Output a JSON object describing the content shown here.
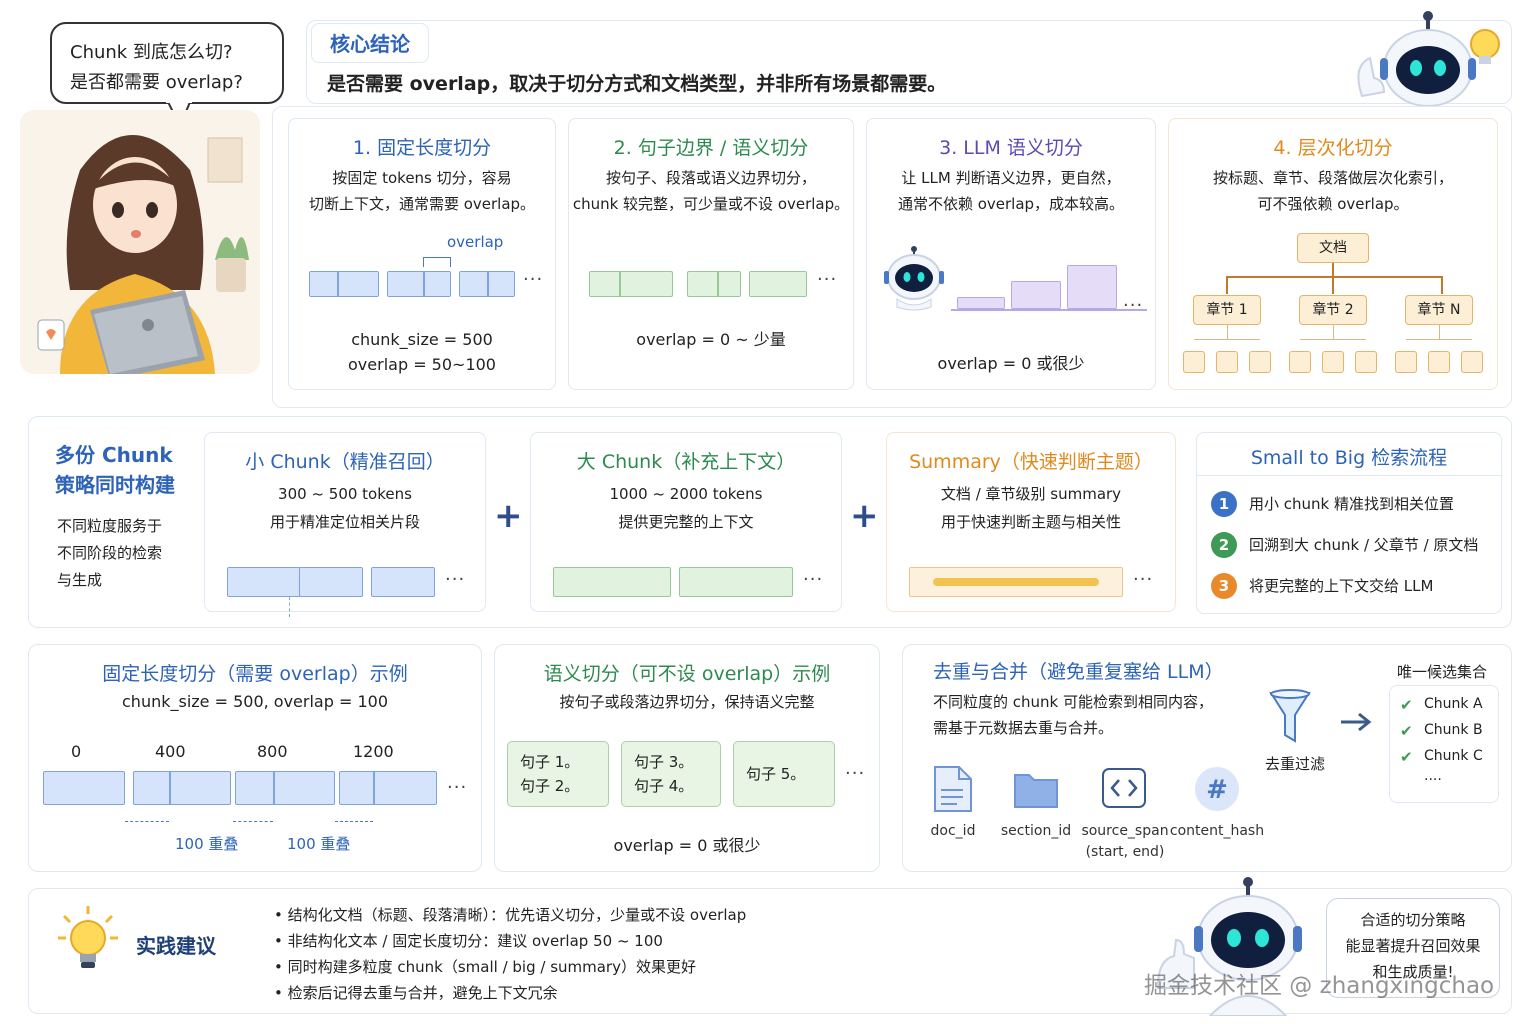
{
  "speech": {
    "line1": "Chunk 到底怎么切?",
    "line2": "是否都需要 overlap?"
  },
  "conclusion": {
    "tag": "核心结论",
    "text": "是否需要 overlap，取决于切分方式和文档类型，并非所有场景都需要。"
  },
  "methods": [
    {
      "title": "1. 固定长度切分",
      "desc1": "按固定 tokens 切分，容易",
      "desc2": "切断上下文，通常需要 overlap。",
      "overlap_label": "overlap",
      "param1": "chunk_size = 500",
      "param2": "overlap = 50~100"
    },
    {
      "title": "2. 句子边界 / 语义切分",
      "desc1": "按句子、段落或语义边界切分，",
      "desc2": "chunk 较完整，可少量或不设 overlap。",
      "param1": "overlap = 0 ~ 少量"
    },
    {
      "title": "3. LLM 语义切分",
      "desc1": "让 LLM 判断语义边界，更自然，",
      "desc2": "通常不依赖 overlap，成本较高。",
      "param1": "overlap = 0 或很少"
    },
    {
      "title": "4. 层次化切分",
      "desc1": "按标题、章节、段落做层次化索引，",
      "desc2": "可不强依赖 overlap。",
      "root": "文档",
      "nodes": [
        "章节 1",
        "章节 2",
        "章节 N"
      ]
    }
  ],
  "multi": {
    "title1": "多份 Chunk",
    "title2": "策略同时构建",
    "desc": [
      "不同粒度服务于",
      "不同阶段的检索",
      "与生成"
    ],
    "small": {
      "title": "小 Chunk（精准召回）",
      "l1": "300 ~ 500 tokens",
      "l2": "用于精准定位相关片段"
    },
    "big": {
      "title": "大 Chunk（补充上下文）",
      "l1": "1000 ~ 2000 tokens",
      "l2": "提供更完整的上下文"
    },
    "summary": {
      "title": "Summary（快速判断主题）",
      "l1": "文档 / 章节级别 summary",
      "l2": "用于快速判断主题与相关性"
    },
    "plus": "+",
    "flow": {
      "title": "Small to Big 检索流程",
      "steps": [
        {
          "n": "1",
          "text": "用小 chunk 精准找到相关位置"
        },
        {
          "n": "2",
          "text": "回溯到大 chunk / 父章节 / 原文档"
        },
        {
          "n": "3",
          "text": "将更完整的上下文交给 LLM"
        }
      ]
    }
  },
  "fixed_example": {
    "title": "固定长度切分（需要 overlap）示例",
    "params": "chunk_size = 500, overlap = 100",
    "ticks": [
      "0",
      "400",
      "800",
      "1200"
    ],
    "overlap1": "100 重叠",
    "overlap2": "100 重叠"
  },
  "semantic_example": {
    "title": "语义切分（可不设 overlap）示例",
    "desc": "按句子或段落边界切分，保持语义完整",
    "s1a": "句子 1。",
    "s1b": "句子 2。",
    "s2a": "句子 3。",
    "s2b": "句子 4。",
    "s3": "句子 5。",
    "foot": "overlap = 0 或很少"
  },
  "dedup": {
    "title": "去重与合并（避免重复塞给 LLM）",
    "desc1": "不同粒度的 chunk 可能检索到相同内容，",
    "desc2": "需基于元数据去重与合并。",
    "filter": "去重过滤",
    "set_title": "唯一候选集合",
    "items": [
      "Chunk A",
      "Chunk B",
      "Chunk C"
    ],
    "more": "....",
    "icons": [
      {
        "icon": "document-icon",
        "label": "doc_id",
        "label2": ""
      },
      {
        "icon": "folder-icon",
        "label": "section_id",
        "label2": ""
      },
      {
        "icon": "code-icon",
        "label": "source_span",
        "label2": "(start, end)"
      },
      {
        "icon": "hash-icon",
        "label": "content_hash",
        "label2": ""
      }
    ]
  },
  "practice": {
    "title": "实践建议",
    "items": [
      "结构化文档（标题、段落清晰）：优先语义切分，少量或不设 overlap",
      "非结构化文本 / 固定长度切分：建议 overlap 50 ~ 100",
      "同时构建多粒度 chunk（small / big / summary）效果更好",
      "检索后记得去重与合并，避免上下文冗余"
    ],
    "bubble1": "合适的切分策略",
    "bubble2": "能显著提升召回效果",
    "bubble3": "和生成质量!"
  },
  "watermark": "掘金技术社区 @ zhangxingchao",
  "colors": {
    "blue": "#2d63b8",
    "green": "#2d8a4e",
    "orange": "#e08a1e"
  },
  "ellipsis": "···"
}
